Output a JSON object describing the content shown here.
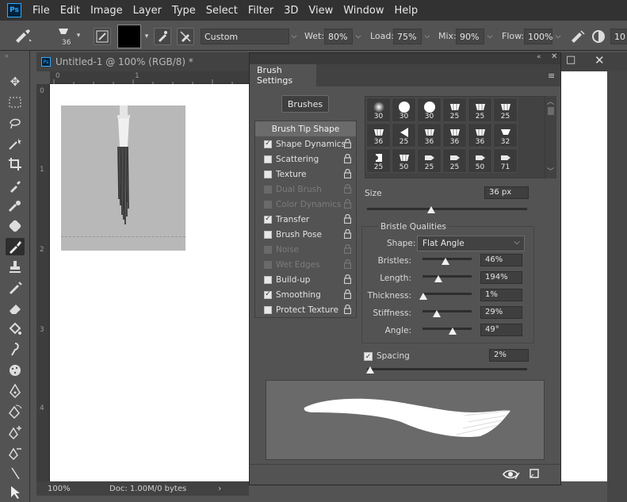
{
  "menu": [
    "File",
    "Edit",
    "Image",
    "Layer",
    "Type",
    "Select",
    "Filter",
    "3D",
    "View",
    "Window",
    "Help"
  ],
  "app_logo": "Ps",
  "options_bar": {
    "brush_size": "36",
    "mix_preset": "Custom",
    "wet_label": "Wet:",
    "wet_value": "80%",
    "load_label": "Load:",
    "load_value": "75%",
    "mix_label": "Mix:",
    "mix_value": "90%",
    "flow_label": "Flow:",
    "flow_value": "100%",
    "extra_value": "10",
    "color_swatch": "#000000"
  },
  "document": {
    "title": "Untitled-1 @ 100% (RGB/8) *",
    "zoom": "100%",
    "doc_info": "Doc: 1.00M/0 bytes",
    "ruler_top": [
      "0",
      "1"
    ],
    "ruler_left": [
      "0",
      "1",
      "2",
      "3",
      "4"
    ]
  },
  "panel": {
    "title": "Brush Settings",
    "brushes_button": "Brushes",
    "options": [
      {
        "label": "Brush Tip Shape",
        "state": "header"
      },
      {
        "label": "Shape Dynamics",
        "state": "checked"
      },
      {
        "label": "Scattering",
        "state": "unchecked"
      },
      {
        "label": "Texture",
        "state": "unchecked"
      },
      {
        "label": "Dual Brush",
        "state": "disabled"
      },
      {
        "label": "Color Dynamics",
        "state": "disabled"
      },
      {
        "label": "Transfer",
        "state": "checked"
      },
      {
        "label": "Brush Pose",
        "state": "unchecked"
      },
      {
        "label": "Noise",
        "state": "disabled"
      },
      {
        "label": "Wet Edges",
        "state": "disabled"
      },
      {
        "label": "Build-up",
        "state": "unchecked"
      },
      {
        "label": "Smoothing",
        "state": "checked"
      },
      {
        "label": "Protect Texture",
        "state": "unchecked"
      }
    ],
    "tips": [
      "30",
      "30",
      "30",
      "25",
      "25",
      "25",
      "36",
      "25",
      "36",
      "36",
      "36",
      "32",
      "25",
      "50",
      "25",
      "25",
      "50",
      "71"
    ],
    "size_label": "Size",
    "size_value": "36 px",
    "size_level": 0.4,
    "bristle_title": "Bristle Qualities",
    "shape_label": "Shape:",
    "shape_value": "Flat Angle",
    "params": [
      {
        "label": "Bristles:",
        "value": "46%",
        "level": 0.46
      },
      {
        "label": "Length:",
        "value": "194%",
        "level": 0.33
      },
      {
        "label": "Thickness:",
        "value": "1%",
        "level": 0.01
      },
      {
        "label": "Stiffness:",
        "value": "29%",
        "level": 0.29
      },
      {
        "label": "Angle:",
        "value": "49°",
        "level": 0.61
      }
    ],
    "spacing_label": "Spacing",
    "spacing_value": "2%",
    "spacing_level": 0.02
  }
}
